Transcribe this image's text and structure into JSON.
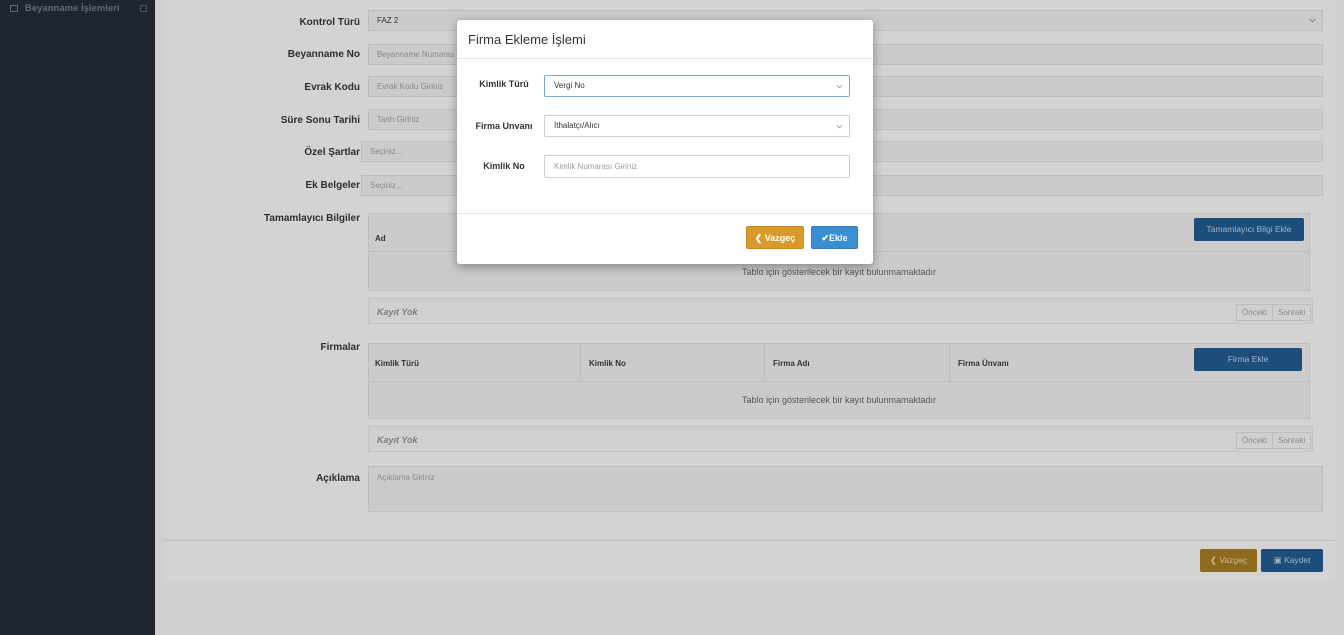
{
  "sidebar": {
    "item_label": "Beyanname İşlemleri"
  },
  "form": {
    "kontrol_turu_label": "Kontrol Türü",
    "kontrol_turu_value": "FAZ 2",
    "beyanname_no_label": "Beyanname No",
    "beyanname_no_placeholder": "Beyanname Numaras",
    "evrak_kodu_label": "Evrak Kodu",
    "evrak_kodu_placeholder": "Evrak Kodu Giriniz",
    "sure_sonu_label": "Süre Sonu Tarihi",
    "sure_sonu_placeholder": "Tarih Giriniz",
    "ozel_sartlar_label": "Özel Şartlar",
    "ozel_sartlar_placeholder": "Seçiniz...",
    "ek_belgeler_label": "Ek Belgeler",
    "ek_belgeler_placeholder": "Seçiniz...",
    "tamamlayici_label": "Tamamlayıcı Bilgiler",
    "tamamlayici_col_ad": "Ad",
    "tamamlayici_add_button": "Tamamlayıcı Bilgi Ekle",
    "empty_table_text": "Tablo için gösterilecek bir kayıt bulunmamaktadır",
    "kayit_yok": "Kayıt Yok",
    "onceki": "Önceki",
    "sonraki": "Sonraki",
    "firmalar_label": "Firmalar",
    "firmalar_columns": [
      "Kimlik Türü",
      "Kimlik No",
      "Firma Adı",
      "Firma Ünvanı"
    ],
    "firma_ekle_button": "Firma Ekle",
    "aciklama_label": "Açıklama",
    "aciklama_placeholder": "Açıklama Giriniz",
    "vazgec_button": "Vazgeç",
    "kaydet_button": "Kaydet"
  },
  "modal": {
    "title": "Firma Ekleme İşlemi",
    "kimlik_turu_label": "Kimlik Türü",
    "kimlik_turu_value": "Vergi No",
    "firma_unvani_label": "Firma Unvanı",
    "firma_unvani_value": "İthalatçı/Alıcı",
    "kimlik_no_label": "Kimlik No",
    "kimlik_no_placeholder": "Kimlik Numarası Giriniz",
    "vazgec_button": "Vazgeç",
    "ekle_button": "Ekle"
  },
  "colors": {
    "sidebar_bg": "#1e2530",
    "accent_blue": "#3a8ed2",
    "accent_orange": "#d99a2b"
  }
}
